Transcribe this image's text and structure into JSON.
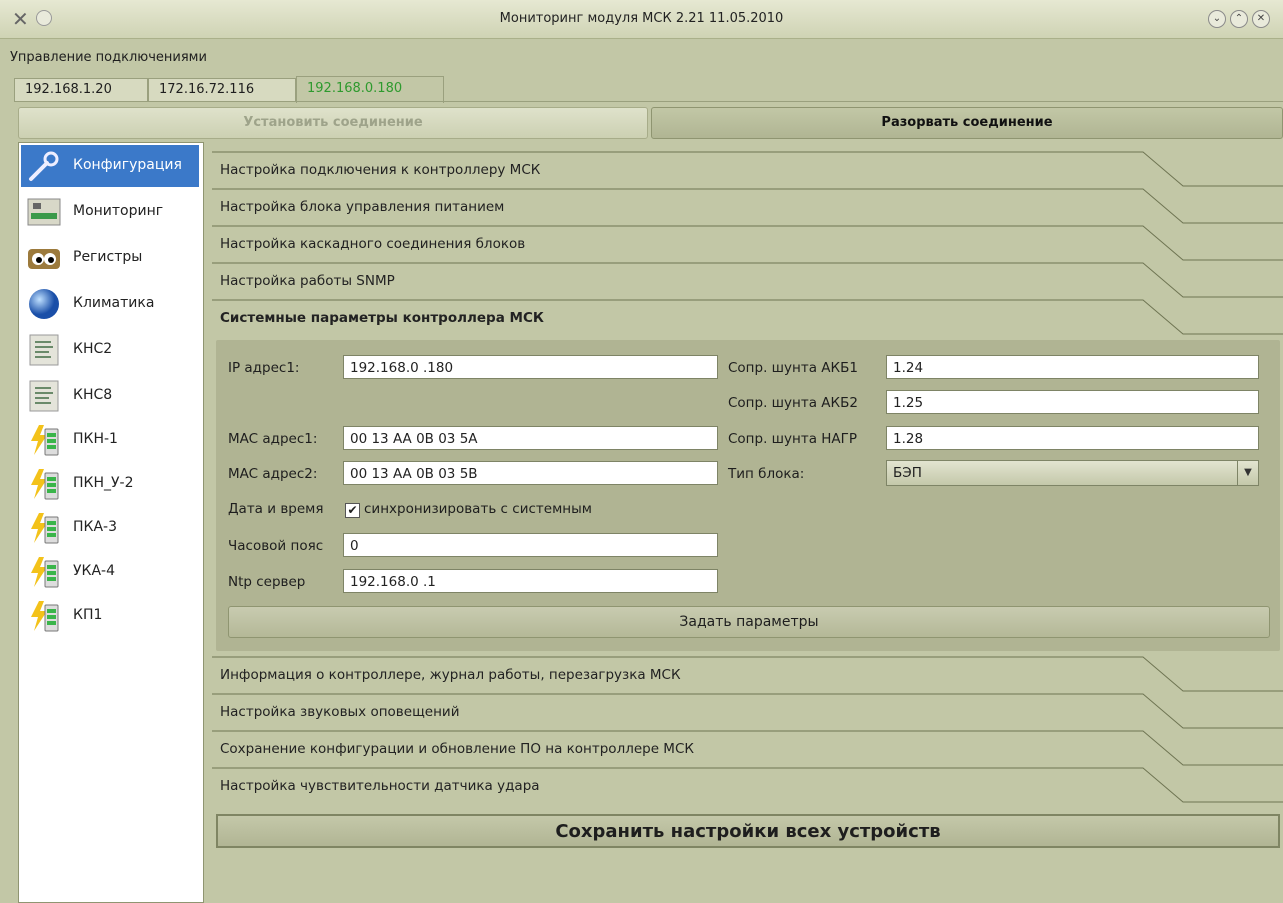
{
  "window": {
    "title": "Мониторинг модуля МСК 2.21 11.05.2010"
  },
  "menu": {
    "connections": "Управление подключениями"
  },
  "tabs": [
    "192.168.1.20",
    "172.16.72.116",
    "192.168.0.180"
  ],
  "connection": {
    "connect": "Установить соединение",
    "disconnect": "Разорвать соединение"
  },
  "sidebar": {
    "items": [
      {
        "label": "Конфигурация",
        "icon": "wrench-icon"
      },
      {
        "label": "Мониторинг",
        "icon": "monitor-board-icon"
      },
      {
        "label": "Регистры",
        "icon": "registers-eyes-icon"
      },
      {
        "label": "Климатика",
        "icon": "globe-icon"
      },
      {
        "label": "КНС2",
        "icon": "document-icon"
      },
      {
        "label": "КНС8",
        "icon": "document-icon"
      },
      {
        "label": "ПКН-1",
        "icon": "battery-lightning-icon"
      },
      {
        "label": "ПКН_У-2",
        "icon": "battery-lightning-icon"
      },
      {
        "label": "ПКА-3",
        "icon": "battery-lightning-icon"
      },
      {
        "label": "УКА-4",
        "icon": "battery-lightning-icon"
      },
      {
        "label": "КП1",
        "icon": "battery-lightning-icon"
      }
    ]
  },
  "sections_top": [
    "Настройка подключения к контроллеру МСК",
    "Настройка блока управления питанием",
    "Настройка каскадного соединения блоков",
    "Настройка работы SNMP",
    "Системные параметры контроллера МСК"
  ],
  "sections_bottom": [
    "Информация о контроллере, журнал работы, перезагрузка МСК",
    "Настройка звуковых оповещений",
    "Сохранение конфигурации и обновление ПО на контроллере МСК",
    "Настройка чувствительности датчика удара"
  ],
  "form": {
    "ip1_label": "IP адрес1:",
    "ip1_value": "192.168.0 .180",
    "mac1_label": "MAC адрес1:",
    "mac1_value": "00 13 AA 0B 03 5A",
    "mac2_label": "MAC адрес2:",
    "mac2_value": "00 13 AA 0B 03 5B",
    "datetime_label": "Дата и время",
    "sync_label": "синхронизировать с системным",
    "sync_checked": true,
    "tz_label": "Часовой пояс",
    "tz_value": "0",
    "ntp_label": "Ntp сервер",
    "ntp_value": "192.168.0 .1",
    "shunt1_label": "Сопр. шунта АКБ1",
    "shunt1_value": "1.24",
    "shunt2_label": "Сопр. шунта АКБ2",
    "shunt2_value": "1.25",
    "shunt3_label": "Сопр. шунта НАГР",
    "shunt3_value": "1.28",
    "type_label": "Тип блока:",
    "type_value": "БЭП",
    "apply": "Задать параметры"
  },
  "save_all": "Сохранить настройки всех устройств"
}
